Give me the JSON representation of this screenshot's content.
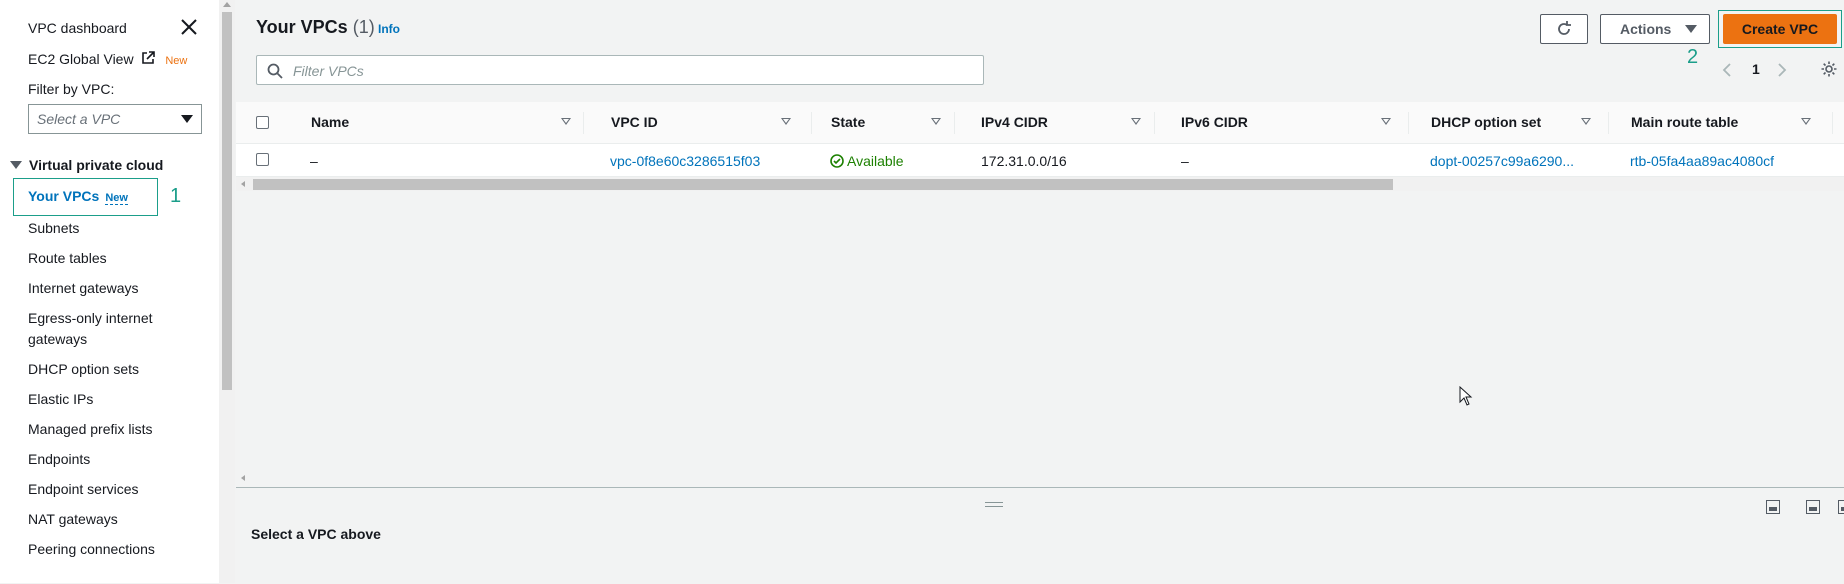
{
  "sidebar": {
    "top_links": [
      {
        "label": "VPC dashboard"
      },
      {
        "label": "EC2 Global View",
        "badge": "New"
      }
    ],
    "filter_label": "Filter by VPC:",
    "filter_placeholder": "Select a VPC",
    "section_title": "Virtual private cloud",
    "active_item": {
      "label": "Your VPCs",
      "badge": "New",
      "step": "1"
    },
    "items": [
      {
        "label": "Subnets"
      },
      {
        "label": "Route tables"
      },
      {
        "label": "Internet gateways"
      },
      {
        "label": "Egress-only internet gateways"
      },
      {
        "label": "DHCP option sets"
      },
      {
        "label": "Elastic IPs"
      },
      {
        "label": "Managed prefix lists"
      },
      {
        "label": "Endpoints"
      },
      {
        "label": "Endpoint services"
      },
      {
        "label": "NAT gateways"
      },
      {
        "label": "Peering connections"
      }
    ]
  },
  "header": {
    "title": "Your VPCs",
    "count": "(1)",
    "info": "Info",
    "actions_label": "Actions",
    "create_label": "Create VPC",
    "create_step": "2"
  },
  "filter": {
    "placeholder": "Filter VPCs"
  },
  "pagination": {
    "current": "1"
  },
  "table": {
    "columns": [
      "Name",
      "VPC ID",
      "State",
      "IPv4 CIDR",
      "IPv6 CIDR",
      "DHCP option set",
      "Main route table"
    ],
    "rows": [
      {
        "name": "–",
        "vpc_id": "vpc-0f8e60c3286515f03",
        "state": "Available",
        "ipv4": "172.31.0.0/16",
        "ipv6": "–",
        "dhcp": "dopt-00257c99a6290...",
        "route_table": "rtb-05fa4aa89ac4080cf"
      }
    ]
  },
  "split_panel": {
    "title": "Select a VPC above"
  },
  "colors": {
    "accent": "#0073bb",
    "primary_button": "#ec7211",
    "success": "#1d8102",
    "highlight": "#1b9e8a"
  }
}
